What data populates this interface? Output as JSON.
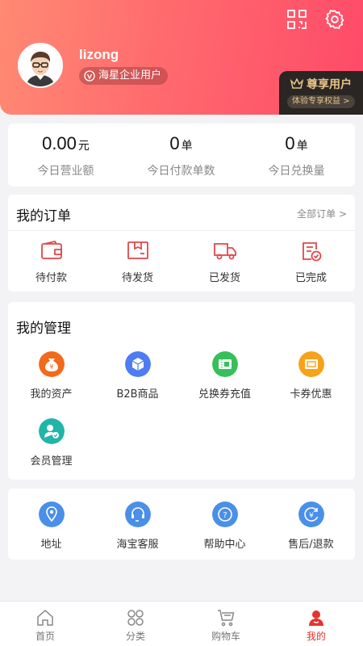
{
  "header": {
    "username": "lizong",
    "badge": "海星企业用户",
    "vip": {
      "title": "尊享用户",
      "subtitle": "体验专享权益 >"
    }
  },
  "stats": [
    {
      "value": "0.00",
      "unit": "元",
      "label": "今日营业额"
    },
    {
      "value": "0",
      "unit": "单",
      "label": "今日付款单数"
    },
    {
      "value": "0",
      "unit": "单",
      "label": "今日兑换量"
    }
  ],
  "orders": {
    "title": "我的订单",
    "more": "全部订单 >",
    "items": [
      {
        "label": "待付款",
        "icon": "wallet-icon"
      },
      {
        "label": "待发货",
        "icon": "box-icon"
      },
      {
        "label": "已发货",
        "icon": "truck-icon"
      },
      {
        "label": "已完成",
        "icon": "checklist-icon"
      }
    ]
  },
  "manage": {
    "title": "我的管理",
    "items": [
      {
        "label": "我的资产",
        "icon": "money-bag-icon",
        "color": "#f26a1b"
      },
      {
        "label": "B2B商品",
        "icon": "cube-icon",
        "color": "#4e7cf2"
      },
      {
        "label": "兑换券充值",
        "icon": "coupon-icon",
        "color": "#35c05b"
      },
      {
        "label": "卡券优惠",
        "icon": "card-icon",
        "color": "#f7a21a"
      },
      {
        "label": "会员管理",
        "icon": "member-icon",
        "color": "#20b5a8"
      }
    ]
  },
  "services": {
    "items": [
      {
        "label": "地址",
        "icon": "location-icon"
      },
      {
        "label": "海宝客服",
        "icon": "headset-icon"
      },
      {
        "label": "帮助中心",
        "icon": "help-icon"
      },
      {
        "label": "售后/退款",
        "icon": "refund-icon"
      }
    ]
  },
  "tabbar": {
    "items": [
      {
        "label": "首页",
        "icon": "home-icon"
      },
      {
        "label": "分类",
        "icon": "category-icon"
      },
      {
        "label": "购物车",
        "icon": "cart-icon"
      },
      {
        "label": "我的",
        "icon": "profile-icon"
      }
    ],
    "active": "我的"
  },
  "colors": {
    "header_start": "#ff8a73",
    "header_end": "#fe4a68",
    "order_icon_red": "#e0484a",
    "service_blue": "#4a8fe8",
    "active_tab": "#e7322f",
    "vip_gold": "#e8c38a"
  }
}
